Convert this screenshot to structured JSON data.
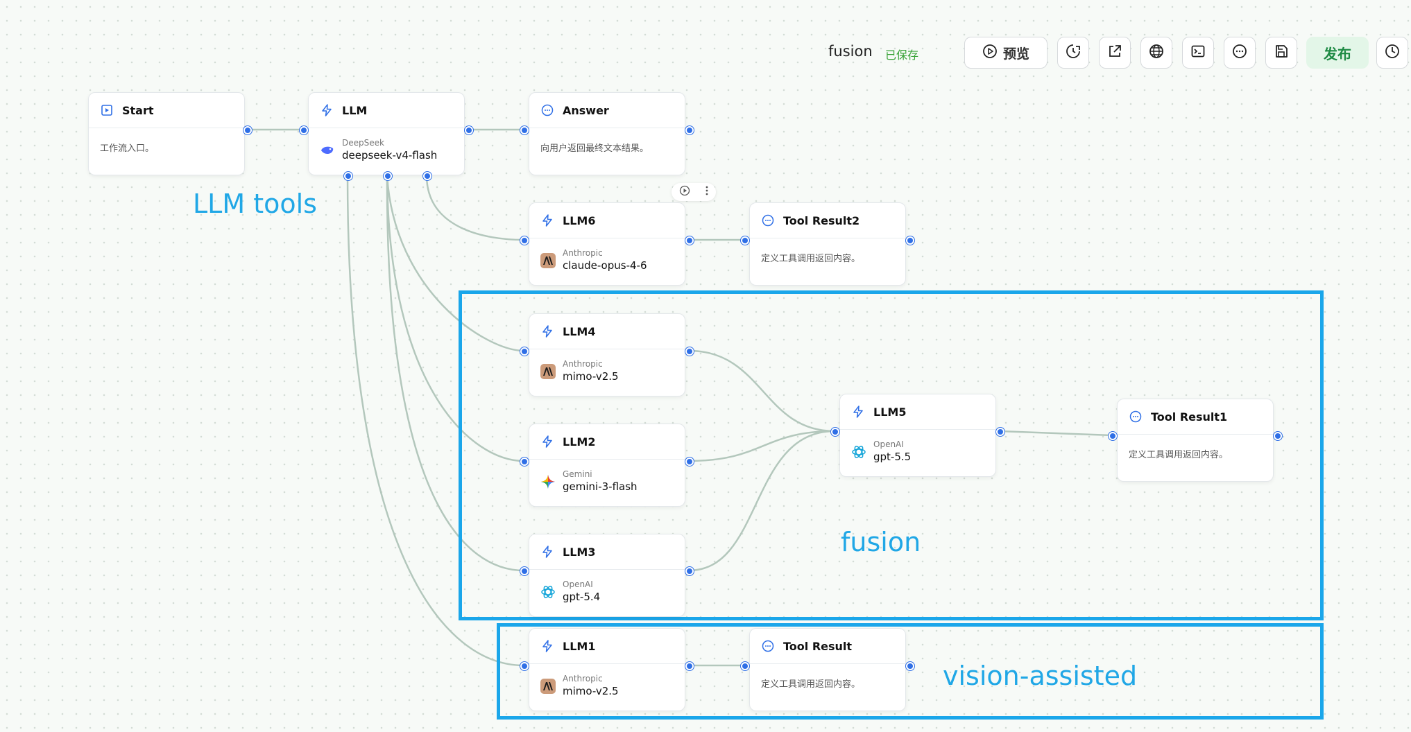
{
  "workflow": {
    "name": "fusion",
    "status": "已保存"
  },
  "toolbar": {
    "preview_label": "预览",
    "publish_label": "发布",
    "icons": [
      "play-circle-icon",
      "history-check-icon",
      "external-link-icon",
      "globe-icon",
      "terminal-icon",
      "chat-bubble-icon",
      "save-icon",
      "clock-icon"
    ]
  },
  "nodes": {
    "start": {
      "title": "Start",
      "desc": "工作流入口。"
    },
    "llm": {
      "title": "LLM",
      "provider": "DeepSeek",
      "model": "deepseek-v4-flash"
    },
    "answer": {
      "title": "Answer",
      "desc": "向用户返回最终文本结果。"
    },
    "llm6": {
      "title": "LLM6",
      "provider": "Anthropic",
      "model": "claude-opus-4-6"
    },
    "tool_result2": {
      "title": "Tool Result2",
      "desc": "定义工具调用返回内容。"
    },
    "llm4": {
      "title": "LLM4",
      "provider": "Anthropic",
      "model": "mimo-v2.5"
    },
    "llm2": {
      "title": "LLM2",
      "provider": "Gemini",
      "model": "gemini-3-flash"
    },
    "llm3": {
      "title": "LLM3",
      "provider": "OpenAI",
      "model": "gpt-5.4"
    },
    "llm5": {
      "title": "LLM5",
      "provider": "OpenAI",
      "model": "gpt-5.5"
    },
    "tool_result1": {
      "title": "Tool Result1",
      "desc": "定义工具调用返回内容。"
    },
    "llm1": {
      "title": "LLM1",
      "provider": "Anthropic",
      "model": "mimo-v2.5"
    },
    "tool_result": {
      "title": "Tool Result",
      "desc": "定义工具调用返回内容。"
    }
  },
  "annotations": {
    "llm_tools": "LLM tools",
    "fusion": "fusion",
    "vision_assisted": "vision-assisted"
  },
  "colors": {
    "accent": "#2f6fe6",
    "annotation": "#1aa6ea",
    "saved": "#3aa338",
    "publish_bg": "#e3f6e8",
    "publish_text": "#1e8a44",
    "edge": "#b3c7bc"
  }
}
